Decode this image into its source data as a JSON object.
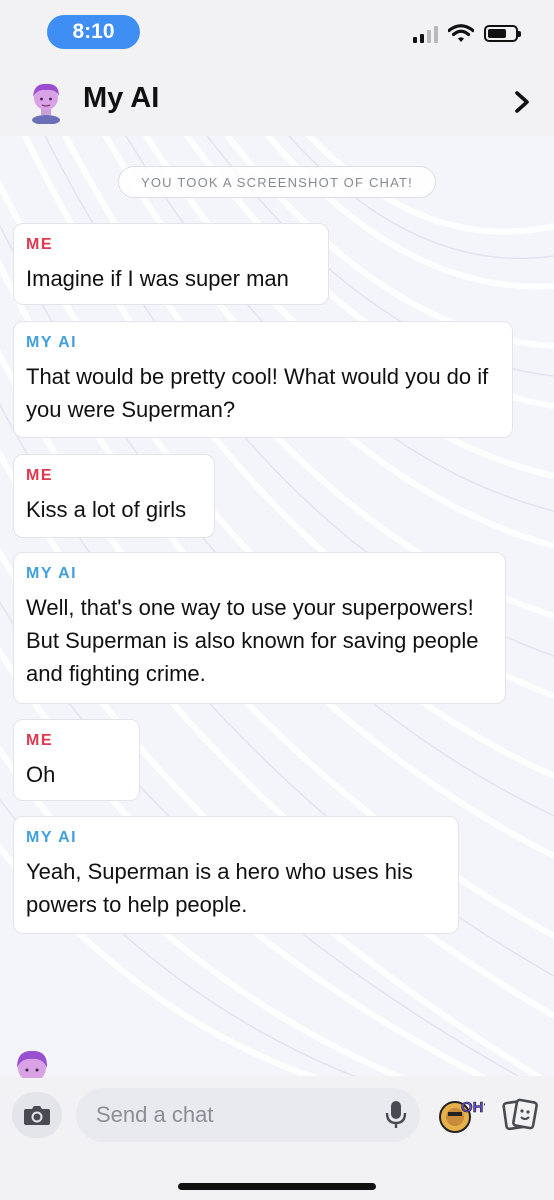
{
  "status_bar": {
    "time": "8:10"
  },
  "header": {
    "title": "My AI"
  },
  "system_notice": "YOU TOOK A SCREENSHOT OF CHAT!",
  "messages": [
    {
      "sender": "ME",
      "text": "Imagine if I was super man"
    },
    {
      "sender": "MY AI",
      "text": "That would be pretty cool! What would you do if you were Superman?"
    },
    {
      "sender": "ME",
      "text": "Kiss a lot of girls"
    },
    {
      "sender": "MY AI",
      "text": "Well, that's one way to use your superpowers! But Superman is also known for saving people and fighting crime."
    },
    {
      "sender": "ME",
      "text": "Oh"
    },
    {
      "sender": "MY AI",
      "text": "Yeah, Superman is a hero who uses his powers to help people."
    }
  ],
  "composer": {
    "placeholder": "Send a chat"
  },
  "bitmoji_text": "OH?",
  "icons": {
    "camera": "camera-icon",
    "mic": "microphone-icon",
    "sticker": "sticker-icon",
    "chevron": "chevron-right-icon"
  },
  "colors": {
    "time_pill": "#3f8ef4",
    "sender_me": "#e0394f",
    "sender_ai": "#42a0e0"
  }
}
